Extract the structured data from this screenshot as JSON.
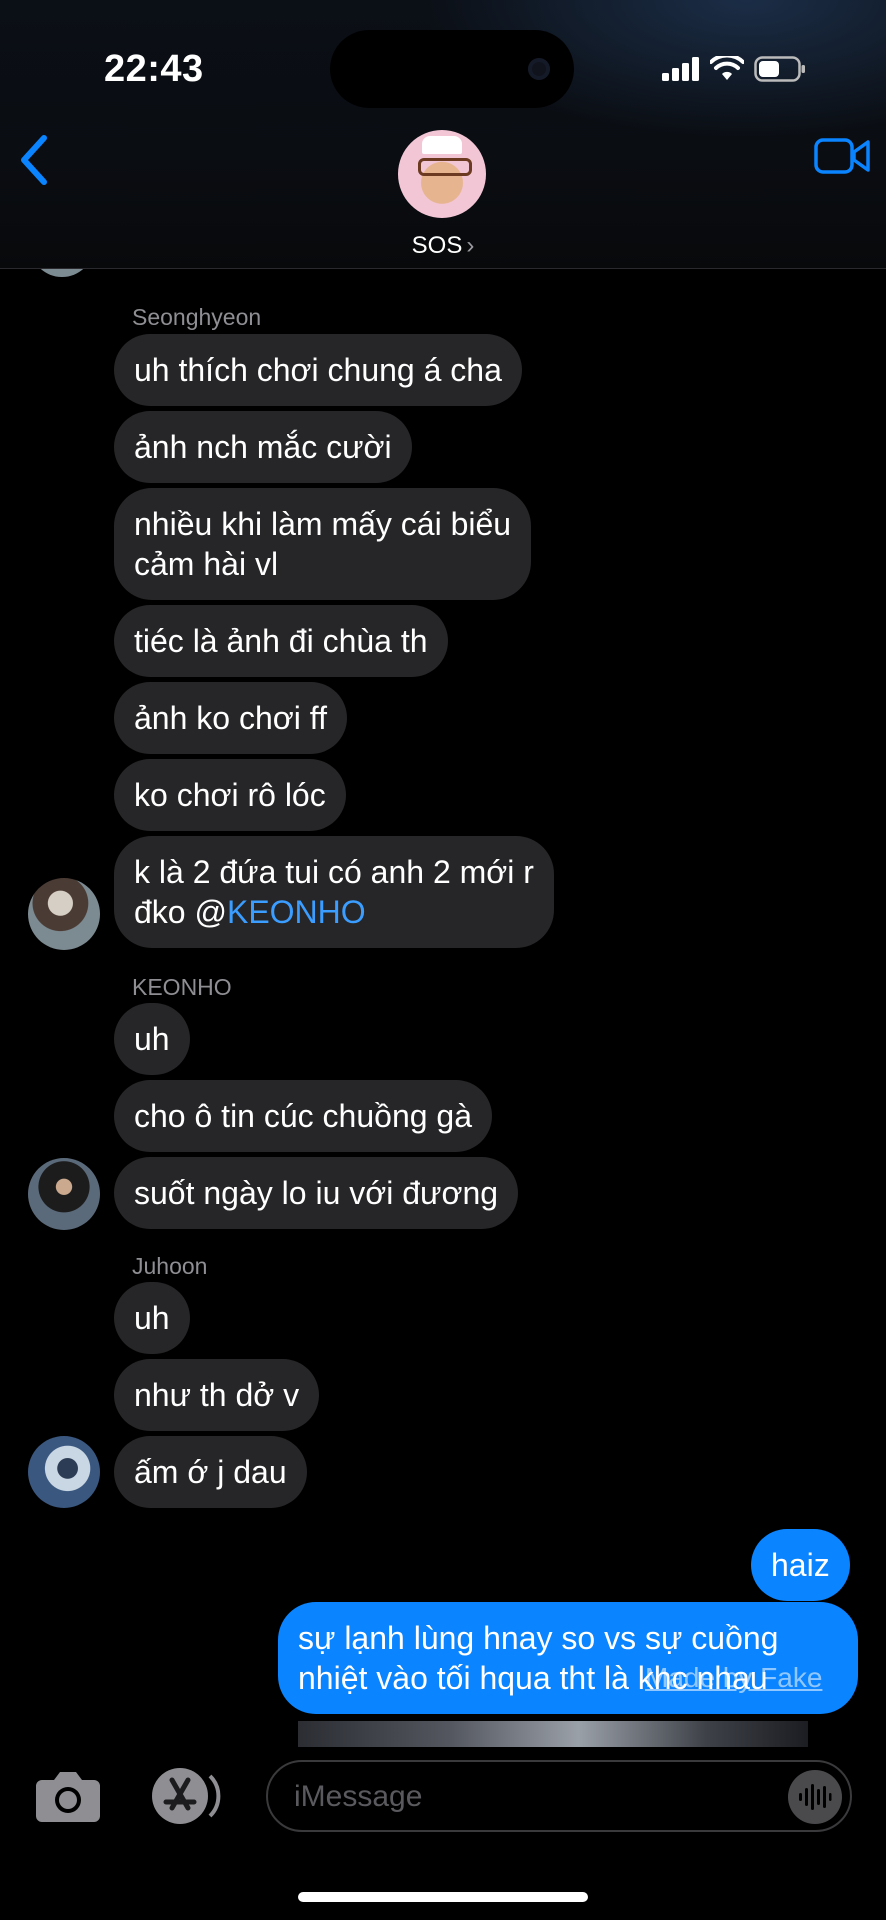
{
  "status_bar": {
    "time": "22:43"
  },
  "header": {
    "contact_name": "SOS",
    "chevron": "›"
  },
  "messages": [
    {
      "text": "uh thích chơi chung á cha"
    },
    {
      "text": "ảnh nch mắc cười"
    },
    {
      "line1": "nhiều khi làm mấy cái biểu",
      "line2": "cảm hài vl"
    },
    {
      "text": "tiéc là ảnh đi chùa th"
    },
    {
      "text": "ảnh ko chơi ff"
    },
    {
      "text": "ko chơi rô lóc"
    },
    {
      "line1": "k là 2 đứa tui có anh 2 mới r",
      "line2_prefix": "đko @",
      "mention": "KEONHO"
    },
    {
      "text": "uh"
    },
    {
      "text": "cho ô tin cúc chuồng gà"
    },
    {
      "text": "suốt ngày lo iu với đương"
    },
    {
      "text": "uh"
    },
    {
      "text": "như th dở v"
    },
    {
      "text": "ấm ớ j dau"
    },
    {
      "text": "haiz"
    },
    {
      "line1": "sự lạnh lùng hnay so vs sự cuồng",
      "line2": "nhiệt vào tối hqua tht là khc nhau"
    }
  ],
  "senders": {
    "seonghyeon": "Seonghyeon",
    "keonho": "KEONHO",
    "juhoon": "Juhoon"
  },
  "watermark": "Made by Fake",
  "composer": {
    "placeholder": "iMessage"
  },
  "colors": {
    "incoming_bubble": "#262628",
    "outgoing_bubble": "#0a84ff",
    "accent": "#0a84ff"
  },
  "icons": [
    "back-chevron-icon",
    "video-call-icon",
    "camera-icon",
    "app-store-icon",
    "audio-waveform-icon",
    "signal-icon",
    "wifi-icon",
    "battery-icon"
  ]
}
